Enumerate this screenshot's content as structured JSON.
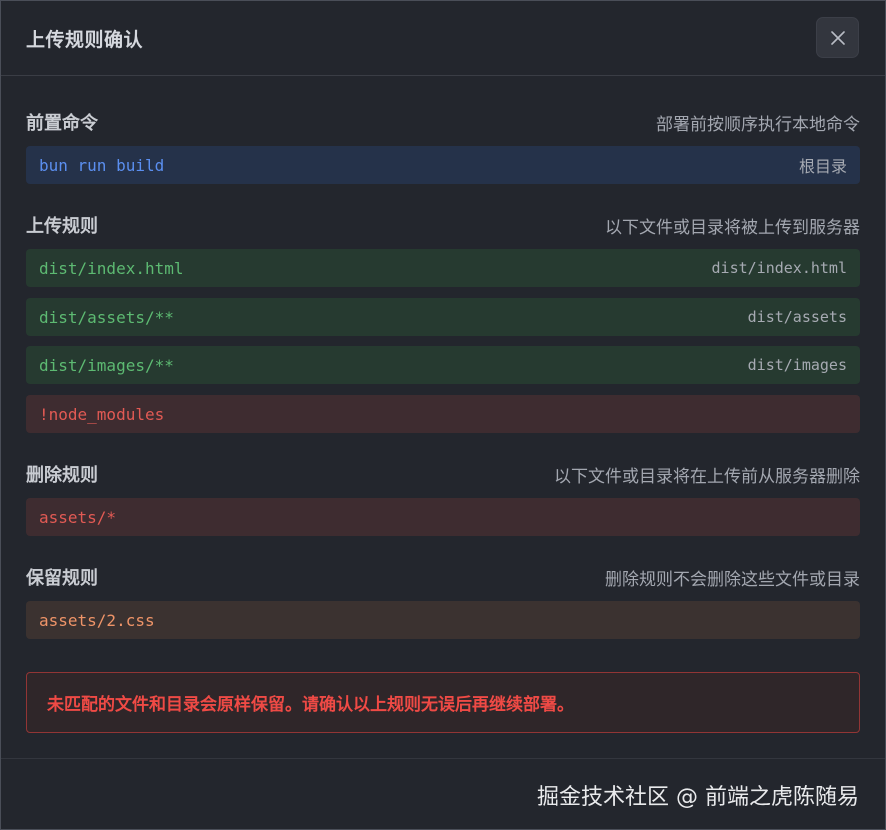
{
  "dialog": {
    "title": "上传规则确认",
    "close_icon": "close-icon"
  },
  "pre_command": {
    "title": "前置命令",
    "desc": "部署前按顺序执行本地命令",
    "command": "bun run build",
    "cwd": "根目录"
  },
  "upload_rules": {
    "title": "上传规则",
    "desc": "以下文件或目录将被上传到服务器",
    "items": [
      {
        "src": "dist/index.html",
        "dest": "dist/index.html"
      },
      {
        "src": "dist/assets/**",
        "dest": "dist/assets"
      },
      {
        "src": "dist/images/**",
        "dest": "dist/images"
      }
    ],
    "exclude": "!node_modules"
  },
  "delete_rules": {
    "title": "删除规则",
    "desc": "以下文件或目录将在上传前从服务器删除",
    "item": "assets/*"
  },
  "keep_rules": {
    "title": "保留规则",
    "desc": "删除规则不会删除这些文件或目录",
    "item": "assets/2.css"
  },
  "warning": "未匹配的文件和目录会原样保留。请确认以上规则无误后再继续部署。",
  "watermark": "掘金技术社区 @ 前端之虎陈随易",
  "colors": {
    "background": "#23262d",
    "command": "#5b8ff0",
    "upload": "#5dba72",
    "delete": "#e25a54",
    "keep": "#ef9468",
    "warning": "#ef4a45"
  }
}
